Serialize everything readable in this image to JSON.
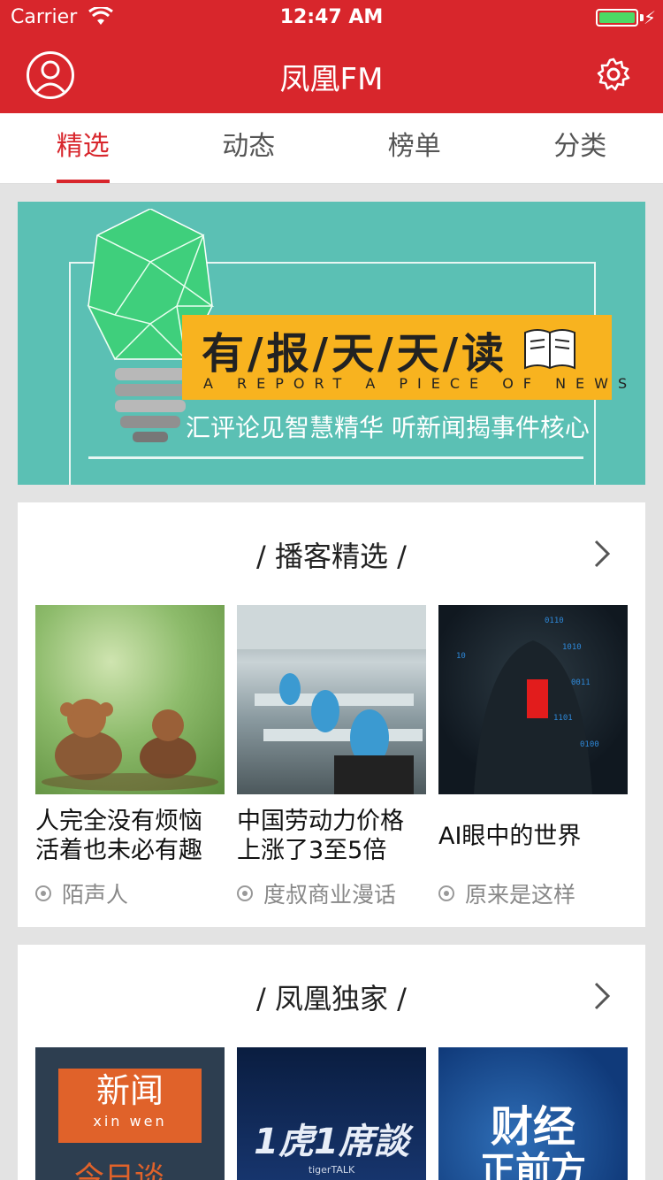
{
  "status_bar": {
    "carrier": "Carrier",
    "time": "12:47 AM",
    "battery_level": 1.0
  },
  "header": {
    "title": "凤凰FM"
  },
  "tabs": [
    {
      "label": "精选",
      "active": true
    },
    {
      "label": "动态",
      "active": false
    },
    {
      "label": "榜单",
      "active": false
    },
    {
      "label": "分类",
      "active": false
    }
  ],
  "banner": {
    "title": "有/报/天/天/读",
    "subtitle": "A REPORT A PIECE OF NEWS",
    "tagline": "汇评论见智慧精华 听新闻揭事件核心"
  },
  "sections": [
    {
      "title": "/ 播客精选 /",
      "cards": [
        {
          "title": "人完全没有烦恼活着也未必有趣",
          "author": "陌声人"
        },
        {
          "title": "中国劳动力价格上涨了3至5倍",
          "author": "度叔商业漫话"
        },
        {
          "title": "AI眼中的世界",
          "author": "原来是这样"
        }
      ]
    },
    {
      "title": "/ 凤凰独家 /",
      "thumbs": [
        {
          "line1": "新闻",
          "line2": "xin wen",
          "line3": "今日谈"
        },
        {
          "line1": "1虎1席談",
          "line2": "tigerTALK"
        },
        {
          "line1": "财经",
          "line2": "正前方"
        }
      ]
    }
  ],
  "colors": {
    "brand": "#d8262c",
    "banner_bg": "#5bc0b4",
    "banner_band": "#f8b31f"
  }
}
